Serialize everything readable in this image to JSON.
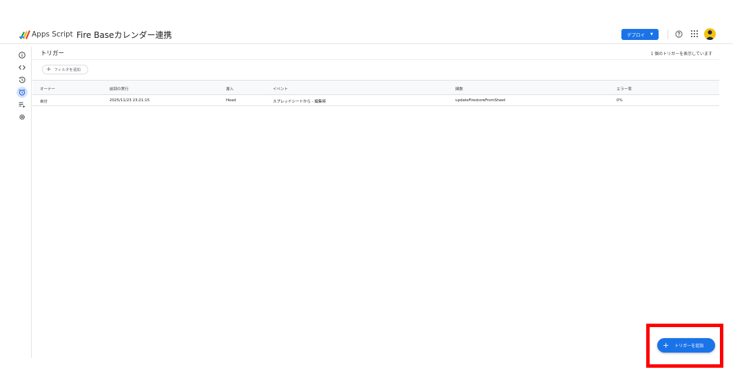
{
  "header": {
    "app_name": "Apps Script",
    "project_title": "Fire Baseカレンダー連携",
    "deploy_label": "デプロイ",
    "icons": [
      "apps-script-logo-icon",
      "help-icon",
      "apps-grid-icon",
      "avatar"
    ]
  },
  "sidebar": {
    "items": [
      {
        "name": "overview",
        "icon": "info-icon",
        "active": false
      },
      {
        "name": "editor",
        "icon": "code-icon",
        "active": false
      },
      {
        "name": "executions",
        "icon": "history-icon",
        "active": false
      },
      {
        "name": "triggers",
        "icon": "alarm-clock-icon",
        "active": true
      },
      {
        "name": "executions-list",
        "icon": "list-play-icon",
        "active": false
      },
      {
        "name": "settings",
        "icon": "gear-icon",
        "active": false
      }
    ]
  },
  "main": {
    "title": "トリガー",
    "status": "1 個のトリガーを表示しています",
    "filter_label": "フィルタを追加",
    "table": {
      "headers": [
        "オーナー",
        "前回の実行",
        "導入",
        "イベント",
        "関数",
        "エラー率"
      ],
      "rows": [
        [
          "自分",
          "2025/11/23 23:21:15",
          "Head",
          "スプレッドシートから - 編集時",
          "updateFirestoreFromSheet",
          "0%"
        ]
      ]
    },
    "add_trigger_label": "トリガーを追加"
  },
  "colors": {
    "accent": "#1a73e8",
    "highlight": "#ff0000",
    "active_nav": "#d3e3fd"
  }
}
